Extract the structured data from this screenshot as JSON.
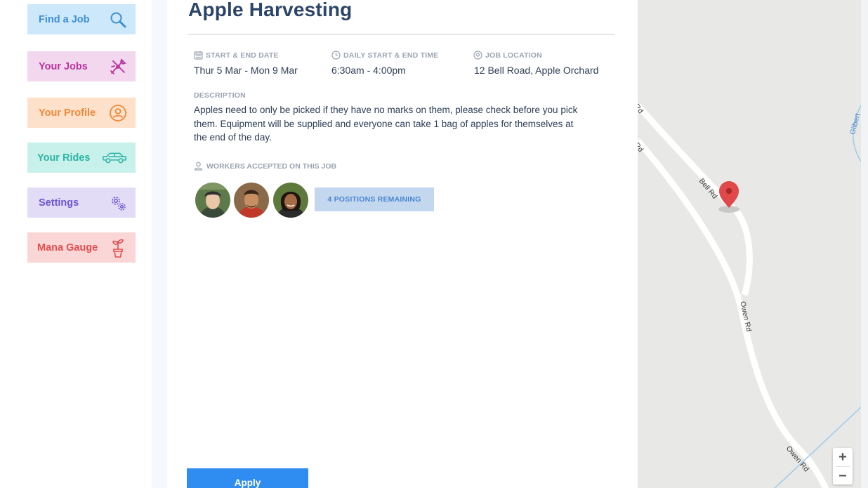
{
  "sidebar": {
    "items": [
      {
        "label": "Find a Job",
        "icon": "search-icon",
        "color": "#3d8fd6"
      },
      {
        "label": "Your Jobs",
        "icon": "tools-icon",
        "color": "#b8369b"
      },
      {
        "label": "Your Profile",
        "icon": "user-circle-icon",
        "color": "#f0883a"
      },
      {
        "label": "Your Rides",
        "icon": "car-icon",
        "color": "#2db4a3"
      },
      {
        "label": "Settings",
        "icon": "gears-icon",
        "color": "#6b55d0"
      },
      {
        "label": "Mana Gauge",
        "icon": "plant-icon",
        "color": "#e0504f"
      }
    ]
  },
  "job": {
    "title": "Apple Harvesting",
    "dates_label": "START & END DATE",
    "dates_value": "Thur 5 Mar - Mon 9 Mar",
    "time_label": "DAILY START & END TIME",
    "time_value": "6:30am - 4:00pm",
    "location_label": "JOB LOCATION",
    "location_value": "12 Bell Road, Apple Orchard",
    "description_label": "DESCRIPTION",
    "description": "Apples need to only be picked if they have no marks on them, please check before you pick them. Equipment will be supplied and everyone can take 1 bag of apples for themselves at the end of the day.",
    "workers_label": "WORKERS ACCEPTED ON THIS JOB",
    "positions_remaining": "4 POSITIONS REMAINING",
    "apply_label": "Apply"
  },
  "map": {
    "roads": [
      "Rd",
      "Rd",
      "Bell Rd",
      "Owen Rd",
      "Owen Rd",
      "Gilbert"
    ],
    "zoom_in": "+",
    "zoom_out": "−",
    "pin_color": "#e0484a"
  }
}
